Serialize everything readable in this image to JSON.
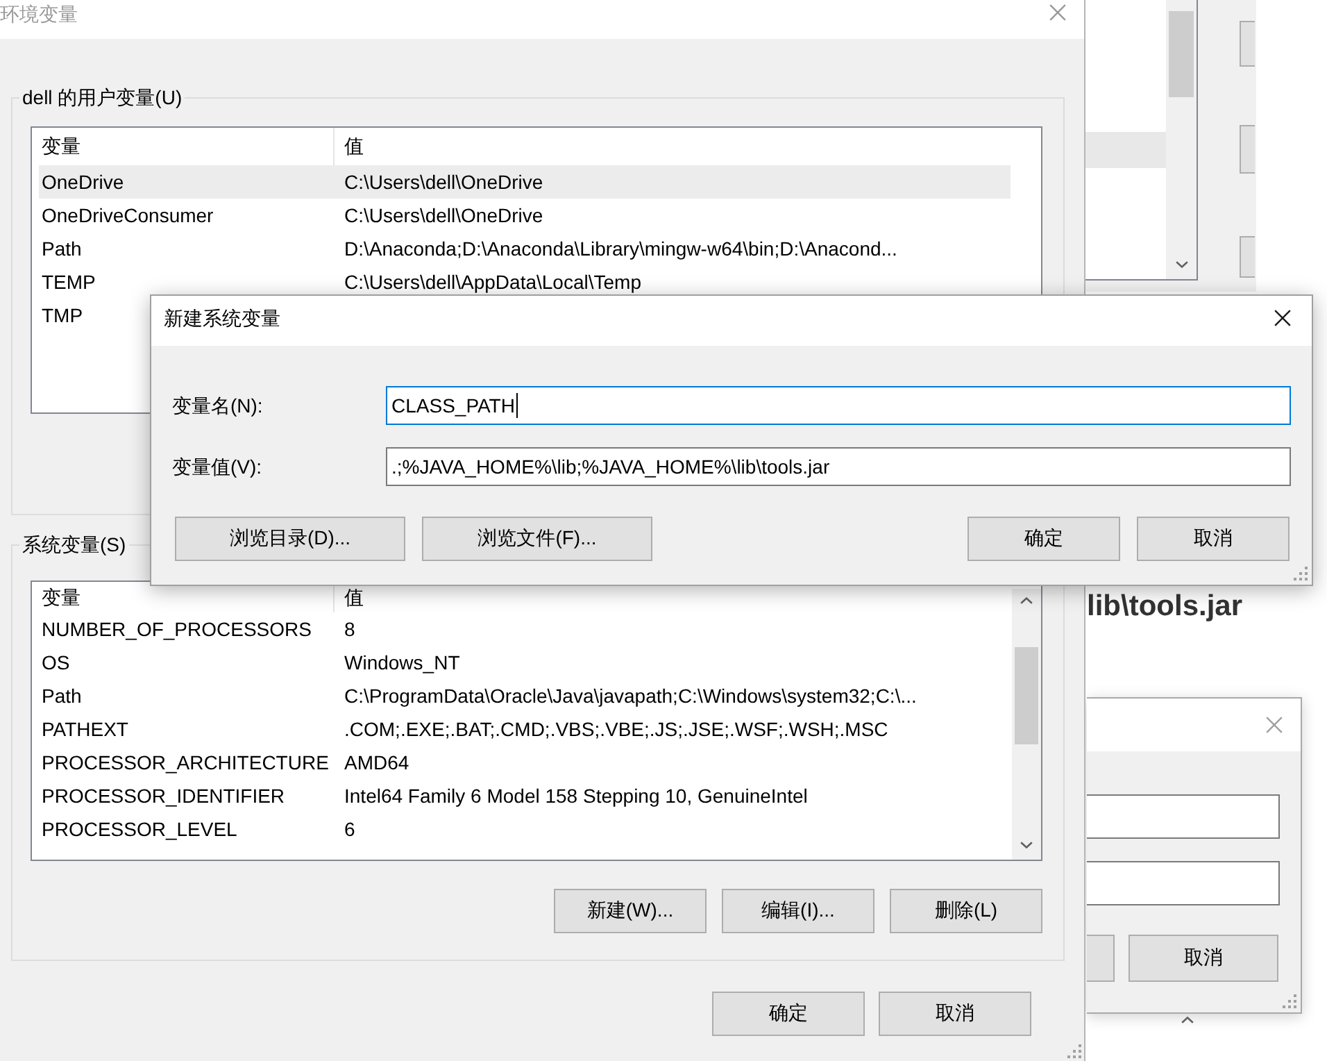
{
  "main_window": {
    "title": "环境变量",
    "user_variables": {
      "label": "dell 的用户变量(U)",
      "columns": [
        "变量",
        "值"
      ],
      "rows": [
        {
          "name": "OneDrive",
          "value": "C:\\Users\\dell\\OneDrive",
          "selected": true
        },
        {
          "name": "OneDriveConsumer",
          "value": "C:\\Users\\dell\\OneDrive",
          "selected": false
        },
        {
          "name": "Path",
          "value": "D:\\Anaconda;D:\\Anaconda\\Library\\mingw-w64\\bin;D:\\Anacond...",
          "selected": false
        },
        {
          "name": "TEMP",
          "value": "C:\\Users\\dell\\AppData\\Local\\Temp",
          "selected": false
        },
        {
          "name": "TMP",
          "selected": false
        }
      ]
    },
    "system_variables": {
      "label": "系统变量(S)",
      "columns": [
        "变量",
        "值"
      ],
      "rows": [
        {
          "name": "NUMBER_OF_PROCESSORS",
          "value": "8",
          "selected": false
        },
        {
          "name": "OS",
          "value": "Windows_NT",
          "selected": false
        },
        {
          "name": "Path",
          "value": "C:\\ProgramData\\Oracle\\Java\\javapath;C:\\Windows\\system32;C:\\...",
          "selected": false
        },
        {
          "name": "PATHEXT",
          "value": ".COM;.EXE;.BAT;.CMD;.VBS;.VBE;.JS;.JSE;.WSF;.WSH;.MSC",
          "selected": false
        },
        {
          "name": "PROCESSOR_ARCHITECTURE",
          "value": "AMD64",
          "selected": false
        },
        {
          "name": "PROCESSOR_IDENTIFIER",
          "value": "Intel64 Family 6 Model 158 Stepping 10, GenuineIntel",
          "selected": false
        },
        {
          "name": "PROCESSOR_LEVEL",
          "value": "6",
          "selected": false
        }
      ],
      "buttons": [
        "新建(W)...",
        "编辑(I)...",
        "删除(L)"
      ]
    },
    "buttons": [
      "确定",
      "取消"
    ]
  },
  "dialog": {
    "title": "新建系统变量",
    "fields": [
      {
        "label": "变量名(N):",
        "value": "CLASS_PATH",
        "focused": true
      },
      {
        "label": "变量值(V):",
        "value": ".;%JAVA_HOME%\\lib;%JAVA_HOME%\\lib\\tools.jar",
        "focused": false
      }
    ],
    "browse_buttons": [
      "浏览目录(D)...",
      "浏览文件(F)..."
    ],
    "buttons": [
      "确定",
      "取消"
    ]
  },
  "background": {
    "list": {
      "selected_row": true
    },
    "text": "lib\\tools.jar",
    "dialog": {
      "buttons": [
        "取消"
      ]
    }
  }
}
